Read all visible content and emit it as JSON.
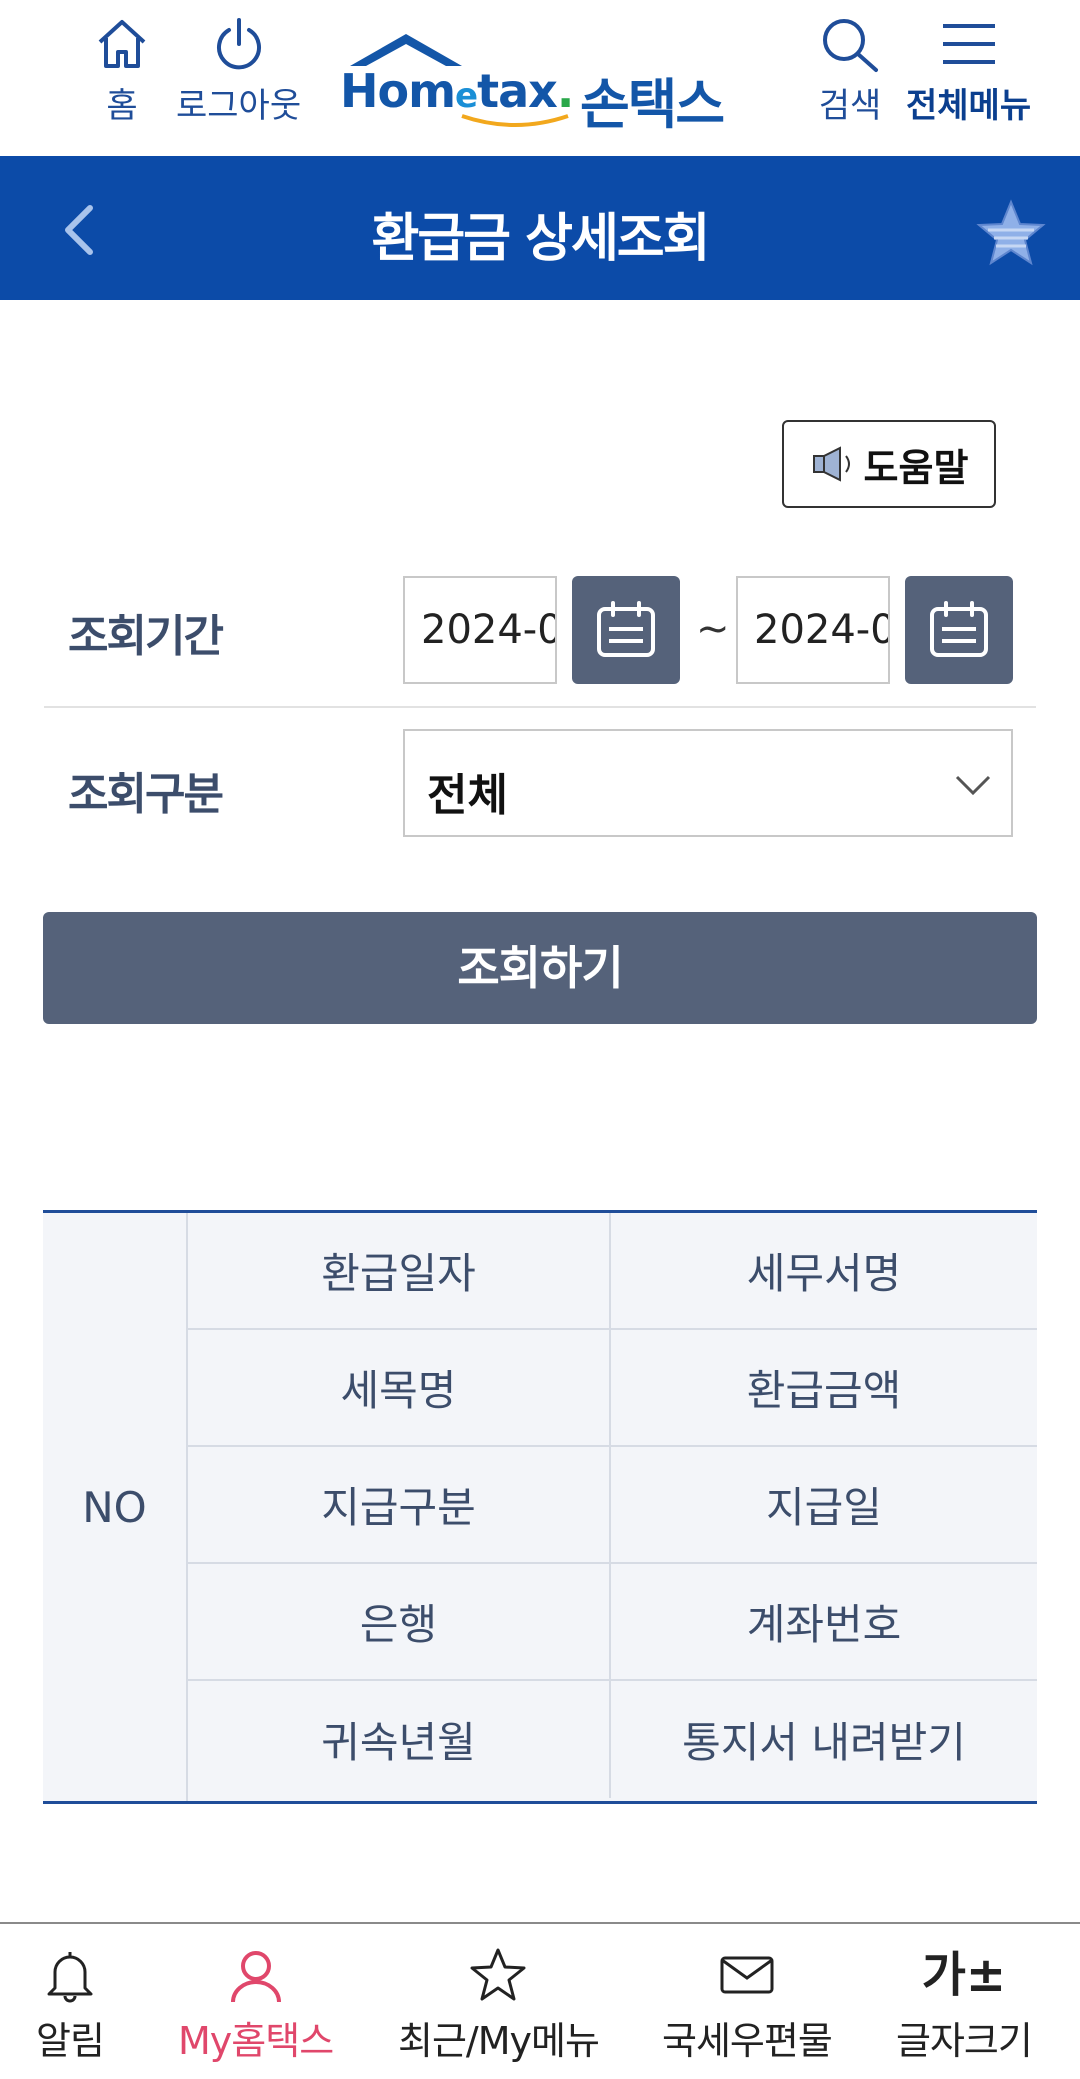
{
  "header": {
    "home_label": "홈",
    "logout_label": "로그아웃",
    "logo_text_en": "Hometax.",
    "logo_text_ko": "손택스",
    "search_label": "검색",
    "menu_label": "전체메뉴"
  },
  "titlebar": {
    "title": "환급금 상세조회"
  },
  "help": {
    "label": "도움말"
  },
  "form": {
    "period_label": "조회기간",
    "start_date": "2024-0",
    "end_date": "2024-0",
    "tilde": "~",
    "type_label": "조회구분",
    "type_value": "전체",
    "submit_label": "조회하기"
  },
  "table": {
    "no_header": "NO",
    "rows": [
      [
        "환급일자",
        "세무서명"
      ],
      [
        "세목명",
        "환급금액"
      ],
      [
        "지급구분",
        "지급일"
      ],
      [
        "은행",
        "계좌번호"
      ],
      [
        "귀속년월",
        "통지서 내려받기"
      ]
    ]
  },
  "bottom_nav": {
    "items": [
      {
        "label": "알림",
        "icon": "bell-icon"
      },
      {
        "label": "My홈택스",
        "icon": "person-icon",
        "active": true
      },
      {
        "label": "최근/My메뉴",
        "icon": "star-icon"
      },
      {
        "label": "국세우편물",
        "icon": "mail-icon"
      },
      {
        "label": "글자크기",
        "icon": "font-size-icon",
        "glyph": "가±"
      }
    ]
  },
  "colors": {
    "brand_blue": "#0c4ba8",
    "button_gray": "#55627a",
    "active_pink": "#e0476b"
  }
}
